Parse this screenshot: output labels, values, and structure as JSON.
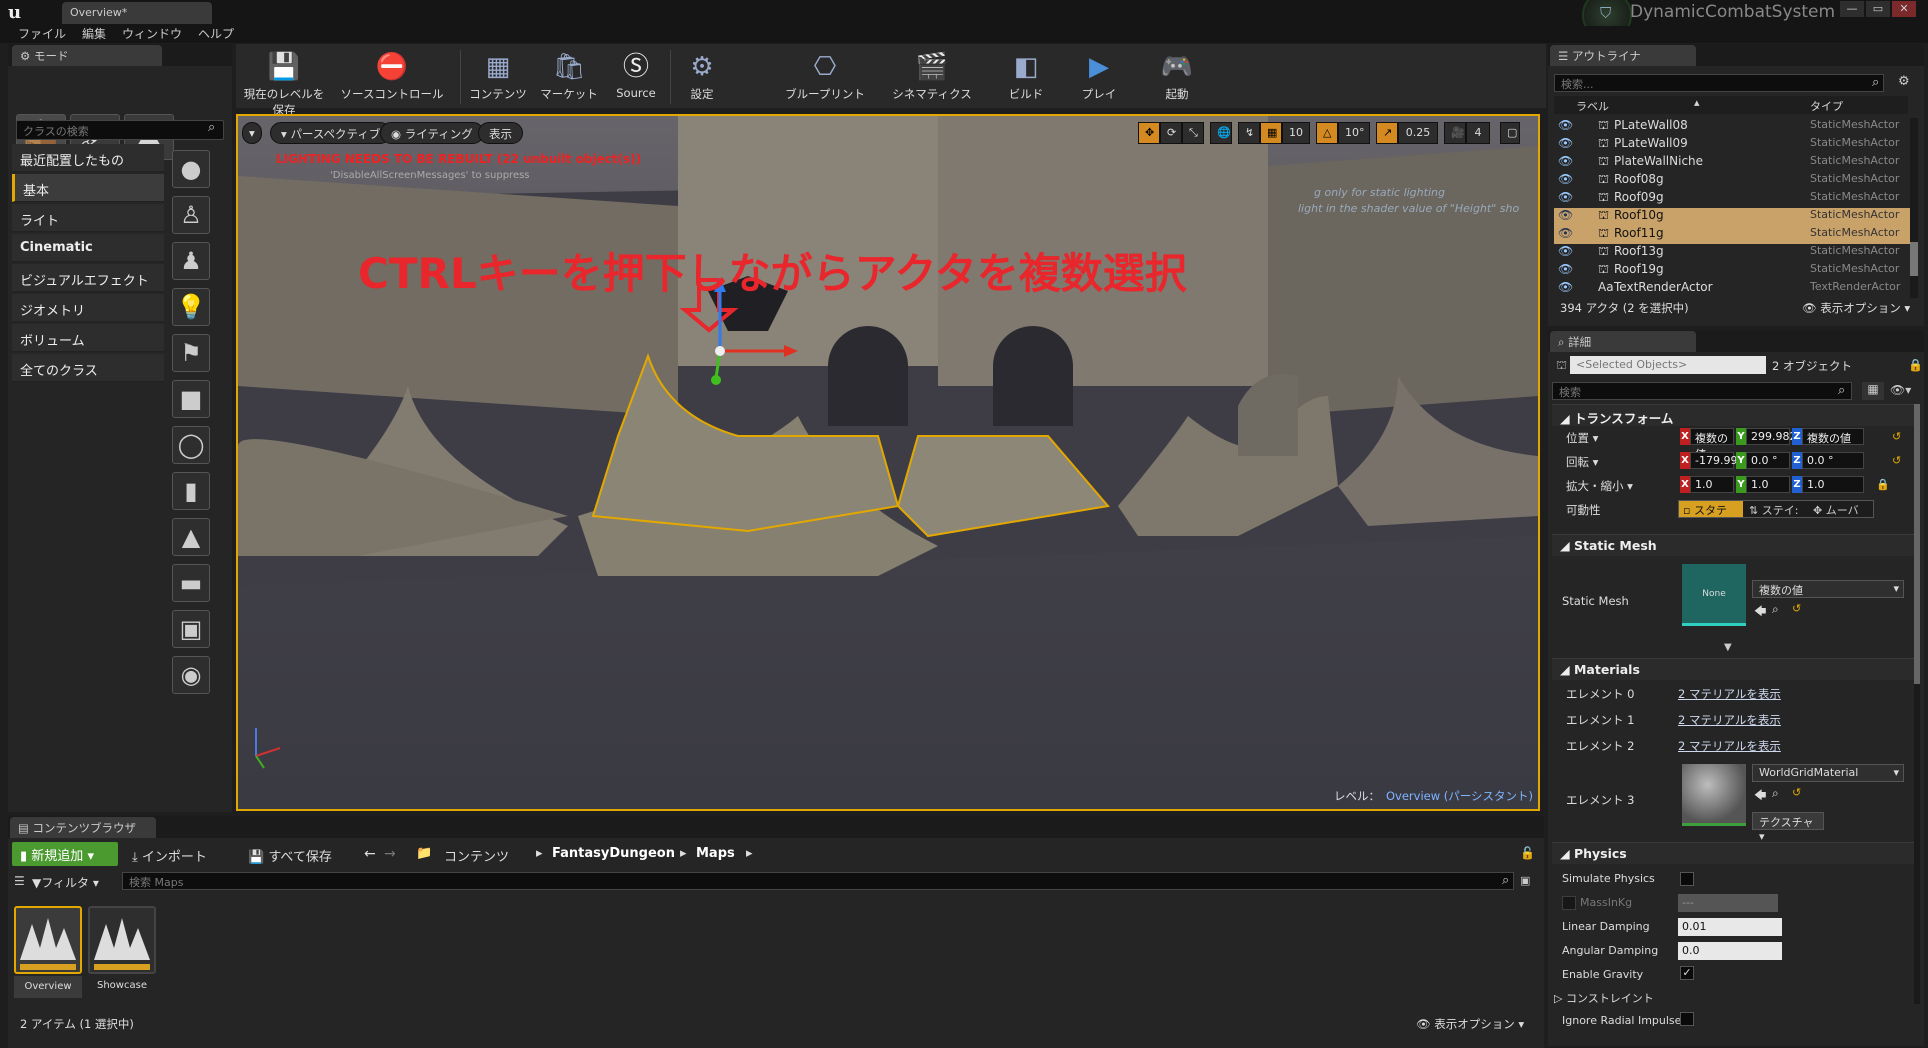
{
  "app": {
    "document_tab": "Overview*",
    "project_name": "DynamicCombatSystem",
    "window_buttons": [
      "—",
      "▭",
      "✕"
    ]
  },
  "menu": [
    "ファイル",
    "編集",
    "ウィンドウ",
    "ヘルプ"
  ],
  "modes": {
    "tab": "モード",
    "search_placeholder": "クラスの検索",
    "categories": [
      "最近配置したもの",
      "基本",
      "ライト",
      "Cinematic",
      "ビジュアルエフェクト",
      "ジオメトリ",
      "ボリューム",
      "全てのクラス"
    ],
    "selected_category": "基本"
  },
  "toolbar": {
    "buttons": [
      "現在のレベルを保存",
      "ソースコントロール",
      "コンテンツ",
      "マーケット",
      "Source",
      "設定",
      "ブループリント",
      "シネマティクス",
      "ビルド",
      "プレイ",
      "起動"
    ]
  },
  "viewport": {
    "perspective": "パースペクティブ",
    "lighting": "ライティング",
    "show": "表示",
    "warning": "LIGHTING NEEDS TO BE REBUILT (22 unbuilt object(s))",
    "subwarning": "'DisableAllScreenMessages' to suppress",
    "bg_text_1": "g only for static lighting",
    "bg_text_2": "light in the shader value of \"Height\" sho",
    "annotation": "CTRLキーを押下しながらアクタを複数選択",
    "grid_snap": "10",
    "rot_snap": "10°",
    "scale_snap": "0.25",
    "camera_speed": "4",
    "level_label": "レベル：",
    "level_name": "Overview (パーシスタント)",
    "annotation_color": "#e8262b",
    "selection_color": "#e3a800"
  },
  "outliner": {
    "tab": "アウトライナ",
    "search_placeholder": "検索...",
    "col_label": "ラベル",
    "col_type": "タイプ",
    "rows": [
      {
        "label": "PLateWall08",
        "type": "StaticMeshActor",
        "selected": false
      },
      {
        "label": "PLateWall09",
        "type": "StaticMeshActor",
        "selected": false
      },
      {
        "label": "PlateWallNiche",
        "type": "StaticMeshActor",
        "selected": false
      },
      {
        "label": "Roof08g",
        "type": "StaticMeshActor",
        "selected": false
      },
      {
        "label": "Roof09g",
        "type": "StaticMeshActor",
        "selected": false
      },
      {
        "label": "Roof10g",
        "type": "StaticMeshActor",
        "selected": true
      },
      {
        "label": "Roof11g",
        "type": "StaticMeshActor",
        "selected": true
      },
      {
        "label": "Roof13g",
        "type": "StaticMeshActor",
        "selected": false
      },
      {
        "label": "Roof19g",
        "type": "StaticMeshActor",
        "selected": false
      },
      {
        "label": "TextRenderActor",
        "type": "TextRenderActor",
        "selected": false
      }
    ],
    "count": "394 アクタ (2 を選択中)",
    "view_options": "表示オプション"
  },
  "details": {
    "tab": "詳細",
    "selected_objects": "<Selected Objects>",
    "object_count": "2 オブジェクト",
    "search_placeholder": "検索",
    "transform_header": "トランスフォーム",
    "location_label": "位置",
    "location": [
      "複数の値",
      "299.982",
      "複数の値"
    ],
    "rotation_label": "回転",
    "rotation": [
      "-179.99",
      "0.0 °",
      "0.0 °"
    ],
    "scale_label": "拡大・縮小",
    "scale": [
      "1.0",
      "1.0",
      "1.0"
    ],
    "mobility_label": "可動性",
    "mobility": [
      "スタテ",
      "ステイ:",
      "ムーバ"
    ],
    "static_mesh_header": "Static Mesh",
    "static_mesh_label": "Static Mesh",
    "static_mesh_thumb": "None",
    "static_mesh_value": "複数の値",
    "materials_header": "Materials",
    "elements": [
      {
        "label": "エレメント 0",
        "value": "2 マテリアルを表示"
      },
      {
        "label": "エレメント 1",
        "value": "2 マテリアルを表示"
      },
      {
        "label": "エレメント 2",
        "value": "2 マテリアルを表示"
      },
      {
        "label": "エレメント 3",
        "value": "WorldGridMaterial"
      }
    ],
    "texture_button": "テクスチャ",
    "physics_header": "Physics",
    "simulate_physics": "Simulate Physics",
    "mass": "MassInKg",
    "mass_value": "---",
    "linear_damping_label": "Linear Damping",
    "linear_damping": "0.01",
    "angular_damping_label": "Angular Damping",
    "angular_damping": "0.0",
    "enable_gravity": "Enable Gravity",
    "constraints": "コンストレイント",
    "ignore_radial": "Ignore Radial Impulse"
  },
  "content_browser": {
    "tab": "コンテンツブラウザ",
    "add_new": "新規追加",
    "import": "インポート",
    "save_all": "すべて保存",
    "path": [
      "コンテンツ",
      "FantasyDungeon",
      "Maps"
    ],
    "filter": "フィルタ",
    "search_placeholder": "検索 Maps",
    "assets": [
      "Overview",
      "Showcase"
    ],
    "item_count": "2 アイテム (1 選択中)",
    "view_options": "表示オプション"
  }
}
